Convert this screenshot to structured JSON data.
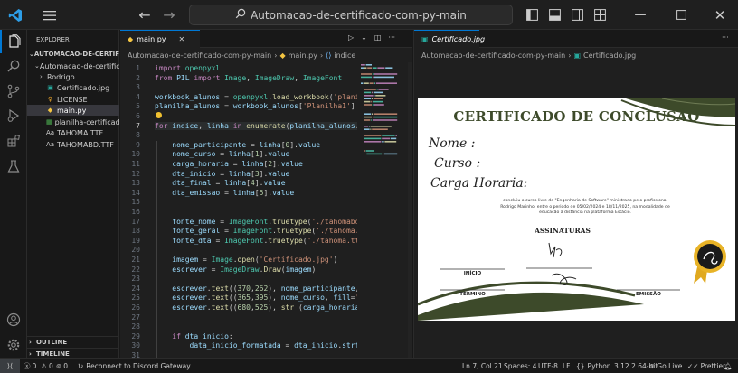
{
  "titlebar": {
    "search_text": "Automacao-de-certificado-com-py-main"
  },
  "activity_icons": [
    "explorer-icon",
    "search-icon",
    "source-control-icon",
    "run-debug-icon",
    "extensions-icon",
    "testing-icon",
    "account-icon",
    "settings-icon"
  ],
  "sidebar": {
    "header": "EXPLORER",
    "root": "AUTOMACAO-DE-CERTIFICA...",
    "folder": "Automacao-de-certifica...",
    "items": [
      {
        "label": "Rodrigo",
        "type": "folder"
      },
      {
        "label": "Certificado.jpg",
        "type": "image"
      },
      {
        "label": "LICENSE",
        "type": "license"
      },
      {
        "label": "main.py",
        "type": "python"
      },
      {
        "label": "planilha-certificad...",
        "type": "excel"
      },
      {
        "label": "TAHOMA.TTF",
        "type": "font"
      },
      {
        "label": "TAHOMABD.TTF",
        "type": "font"
      }
    ],
    "outline": "OUTLINE",
    "timeline": "TIMELINE"
  },
  "editor": {
    "tab": "main.py",
    "breadcrumbs": [
      "Automacao-de-certificado-com-py-main",
      "main.py",
      "indice"
    ],
    "line_numbers": [
      "1",
      "2",
      "3",
      "4",
      "5",
      "6",
      "7",
      "8",
      "9",
      "10",
      "11",
      "12",
      "13",
      "14",
      "15",
      "16",
      "17",
      "18",
      "19",
      "20",
      "21",
      "22",
      "23",
      "24",
      "25",
      "26",
      "27",
      "28",
      "29",
      "30",
      "31",
      "32"
    ],
    "code_lines": [
      "import openpyxl",
      "from PIL import Image, ImageDraw, ImageFont",
      "",
      "workbook_alunos = openpyxl.load_workbook('planilha",
      "planilha_alunos = workbook_alunos['Planilha1']",
      "",
      "for indice, linha in enumerate(planilha_alunos.ite",
      "",
      "    nome_participante = linha[0].value",
      "    nome_curso = linha[1].value",
      "    carga_horaria = linha[2].value",
      "    dta_inicio = linha[3].value",
      "    dta_final = linha[4].value",
      "    dta_emissao = linha[5].value",
      "",
      "",
      "    fonte_nome = ImageFont.truetype('./tahomabd.tt",
      "    fonte_geral = ImageFont.truetype('./tahoma.ttf",
      "    fonte_dta = ImageFont.truetype('./tahoma.ttf',",
      "",
      "    imagem = Image.open('Certificado.jpg')",
      "    escrever = ImageDraw.Draw(imagem)",
      "",
      "    escrever.text((370,262), nome_participante, fi",
      "    escrever.text((365,395), nome_curso, fill='bl",
      "    escrever.text((680,525), str (carga_horaria),",
      "",
      "",
      "    if dta_inicio:",
      "        data_inicio_formatada = dta_inicio.strftim",
      "",
      ""
    ]
  },
  "preview": {
    "tab": "Certificado.jpg",
    "breadcrumbs": [
      "Automacao-de-certificado-com-py-main",
      "Certificado.jpg"
    ],
    "certificate": {
      "title": "CERTIFICADO DE CONCLUSÃO",
      "field_name": "Nome :",
      "field_course": "Curso :",
      "field_hours": "Carga Horaria:",
      "body_line1": "concluiu o curso livre de \"Engenharia de Software\" ministrado pelo profissional",
      "body_line2": "Rodrigo Marinho, entre o periodo de 05/02/2024 e 18/11/2025, na modalidade de",
      "body_line3": "educação à distância na plataforma Estácio.",
      "signatures_title": "ASSINATURAS",
      "label_start": "INÍCIO",
      "label_end": "TÉRMINO",
      "label_emission": "EMISSÃO"
    }
  },
  "statusbar": {
    "errors": "0",
    "warnings": "0",
    "ports": "0",
    "discord": "Reconnect to Discord Gateway",
    "position": "Ln 7, Col 21",
    "spaces": "Spaces: 4",
    "encoding": "UTF-8",
    "eol": "LF",
    "language": "Python",
    "interpreter": "3.12.2 64-bit",
    "golive": "Go Live",
    "prettier": "Prettier"
  },
  "colors": {
    "accent": "#0078d4",
    "cert_green": "#3d4a2a",
    "status_bg": "#181818"
  }
}
